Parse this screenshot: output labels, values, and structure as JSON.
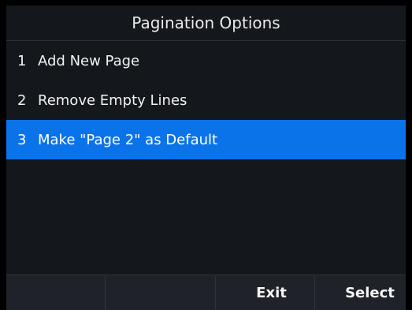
{
  "header": {
    "title": "Pagination Options"
  },
  "menu": {
    "items": [
      {
        "number": "1",
        "label": "Add New Page"
      },
      {
        "number": "2",
        "label": "Remove Empty Lines"
      },
      {
        "number": "3",
        "label": "Make \"Page 2\" as Default"
      }
    ],
    "selected_index": 3
  },
  "softkeys": {
    "exit_label": "Exit",
    "select_label": "Select"
  },
  "colors": {
    "selection": "#0b73ea",
    "background": "#14181d",
    "softkey_bar": "#1f2329"
  }
}
